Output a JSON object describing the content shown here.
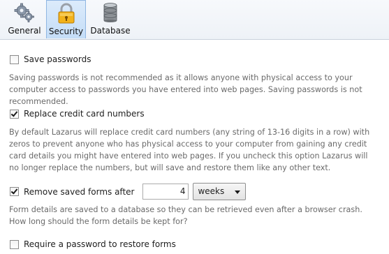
{
  "tabs": [
    {
      "label": "General",
      "icon": "gears-icon"
    },
    {
      "label": "Security",
      "icon": "padlock-icon",
      "selected": true
    },
    {
      "label": "Database",
      "icon": "database-icon"
    }
  ],
  "options": {
    "save_passwords": {
      "label": "Save passwords",
      "checked": false,
      "description": "Saving passwords is not recommended as it allows anyone with physical access to your computer access to passwords you have entered into web pages. Saving passwords is not recommended."
    },
    "replace_cc": {
      "label": "Replace credit card numbers",
      "checked": true,
      "description": "By default Lazarus will replace credit card numbers (any string of 13-16 digits in a row) with zeros to prevent anyone who has physical access to your computer from gaining any credit card details you might have entered into web pages. If you uncheck this option Lazarus will no longer replace the numbers, but will save and restore them like any other text."
    },
    "remove_forms": {
      "label": "Remove saved forms after",
      "checked": true,
      "value": "4",
      "unit": "weeks",
      "description": "Form details are saved to a database so they can be retrieved even after a browser crash. How long should the form details be kept for?"
    },
    "require_password": {
      "label": "Require a password to restore forms",
      "checked": false
    }
  }
}
